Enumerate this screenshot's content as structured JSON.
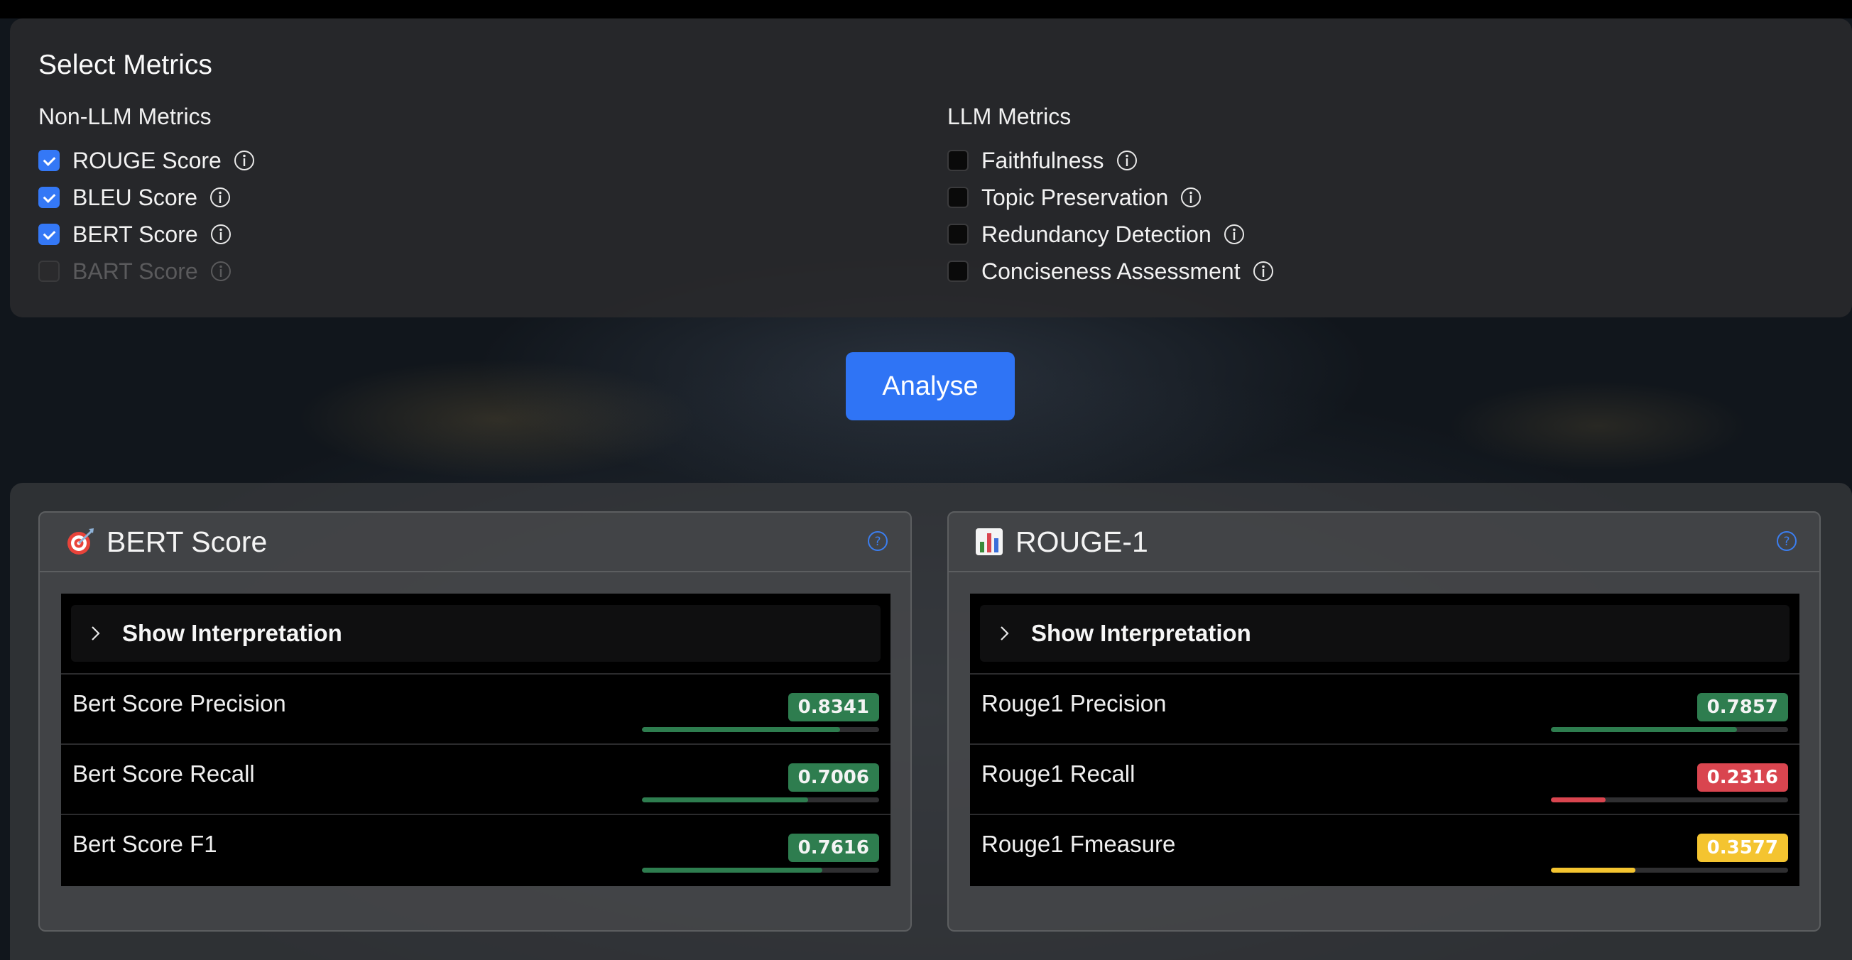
{
  "select_metrics": {
    "title": "Select Metrics",
    "non_llm": {
      "title": "Non-LLM Metrics",
      "items": [
        {
          "label": "ROUGE Score",
          "checked": true,
          "disabled": false
        },
        {
          "label": "BLEU Score",
          "checked": true,
          "disabled": false
        },
        {
          "label": "BERT Score",
          "checked": true,
          "disabled": false
        },
        {
          "label": "BART Score",
          "checked": false,
          "disabled": true
        }
      ]
    },
    "llm": {
      "title": "LLM Metrics",
      "items": [
        {
          "label": "Faithfulness",
          "checked": false,
          "disabled": false
        },
        {
          "label": "Topic Preservation",
          "checked": false,
          "disabled": false
        },
        {
          "label": "Redundancy Detection",
          "checked": false,
          "disabled": false
        },
        {
          "label": "Conciseness Assessment",
          "checked": false,
          "disabled": false
        }
      ]
    }
  },
  "analyse_button": {
    "label": "Analyse"
  },
  "cards": [
    {
      "icon": "target-icon",
      "title": "BERT Score",
      "interpretation_label": "Show Interpretation",
      "metrics": [
        {
          "name": "Bert Score Precision",
          "value": "0.8341",
          "fraction": 0.8341,
          "status": "green"
        },
        {
          "name": "Bert Score Recall",
          "value": "0.7006",
          "fraction": 0.7006,
          "status": "green"
        },
        {
          "name": "Bert Score F1",
          "value": "0.7616",
          "fraction": 0.7616,
          "status": "green"
        }
      ]
    },
    {
      "icon": "bar-chart-icon",
      "title": "ROUGE-1",
      "interpretation_label": "Show Interpretation",
      "metrics": [
        {
          "name": "Rouge1 Precision",
          "value": "0.7857",
          "fraction": 0.7857,
          "status": "green"
        },
        {
          "name": "Rouge1 Recall",
          "value": "0.2316",
          "fraction": 0.2316,
          "status": "red"
        },
        {
          "name": "Rouge1 Fmeasure",
          "value": "0.3577",
          "fraction": 0.3577,
          "status": "yellow"
        }
      ]
    }
  ],
  "colors": {
    "accent": "#2f74f5",
    "good": "#2e7d4f",
    "bad": "#d9454f",
    "warn": "#f4c430"
  }
}
